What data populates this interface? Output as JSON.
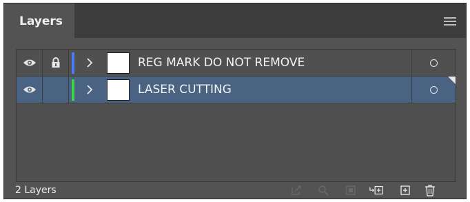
{
  "panel": {
    "tab_title": "Layers",
    "menu_icon": "hamburger-menu-icon"
  },
  "layers": [
    {
      "name": "REG MARK DO NOT REMOVE",
      "visible": true,
      "locked": true,
      "color": "#4b7bf5",
      "selected": false
    },
    {
      "name": "LASER CUTTING",
      "visible": true,
      "locked": false,
      "color": "#3fd24b",
      "selected": true
    }
  ],
  "footer": {
    "count_label": "2 Layers",
    "buttons": [
      {
        "icon": "export-icon",
        "enabled": false
      },
      {
        "icon": "search-icon",
        "enabled": false
      },
      {
        "icon": "clipping-mask-icon",
        "enabled": false
      },
      {
        "icon": "new-sublayer-icon",
        "enabled": true
      },
      {
        "icon": "new-layer-icon",
        "enabled": true
      },
      {
        "icon": "trash-icon",
        "enabled": true
      }
    ]
  },
  "colors": {
    "panel_bg": "#535353",
    "selected_row": "#4a6383"
  }
}
